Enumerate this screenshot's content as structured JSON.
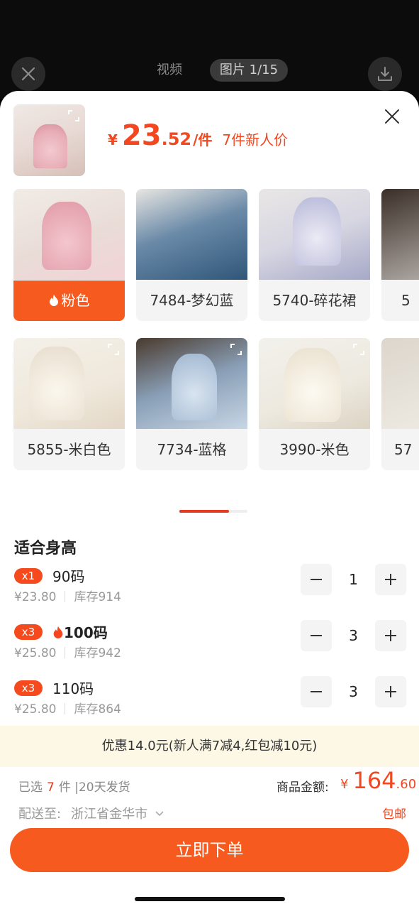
{
  "viewer": {
    "tab_video": "视频",
    "tab_image": "图片 1/15"
  },
  "header": {
    "price_symbol": "¥",
    "price_int": "23",
    "price_dec": ".52",
    "price_unit": "/件",
    "price_note": "7件新人价"
  },
  "variants": [
    {
      "label": "粉色",
      "selected": true,
      "hot": true
    },
    {
      "label": "7484-梦幻蓝"
    },
    {
      "label": "5740-碎花裙"
    },
    {
      "label": "5"
    },
    {
      "label": "5855-米白色"
    },
    {
      "label": "7734-蓝格"
    },
    {
      "label": "3990-米色"
    },
    {
      "label": "57"
    }
  ],
  "section_title": "适合身高",
  "sizes": [
    {
      "badge": "x1",
      "name": "90码",
      "price": "¥23.80",
      "stock": "库存914",
      "qty": "1",
      "hot": false
    },
    {
      "badge": "x3",
      "name": "100码",
      "price": "¥25.80",
      "stock": "库存942",
      "qty": "3",
      "hot": true
    },
    {
      "badge": "x3",
      "name": "110码",
      "price": "¥25.80",
      "stock": "库存864",
      "qty": "3",
      "hot": false
    }
  ],
  "promo": "优惠14.0元(新人满7减4,红包减10元)",
  "summary": {
    "selected_prefix": "已选",
    "selected_count": "7",
    "selected_suffix": "件 |20天发货",
    "total_label": "商品金额:",
    "total_symbol": "¥",
    "total_int": "164",
    "total_dec": ".60",
    "ship_label": "配送至:",
    "ship_addr": "浙江省金华市",
    "free_shipping": "包邮"
  },
  "order_button": "立即下单",
  "colors": {
    "accent": "#f75a1e",
    "price": "#f4471f",
    "promo_bg": "#fdf7e6"
  }
}
